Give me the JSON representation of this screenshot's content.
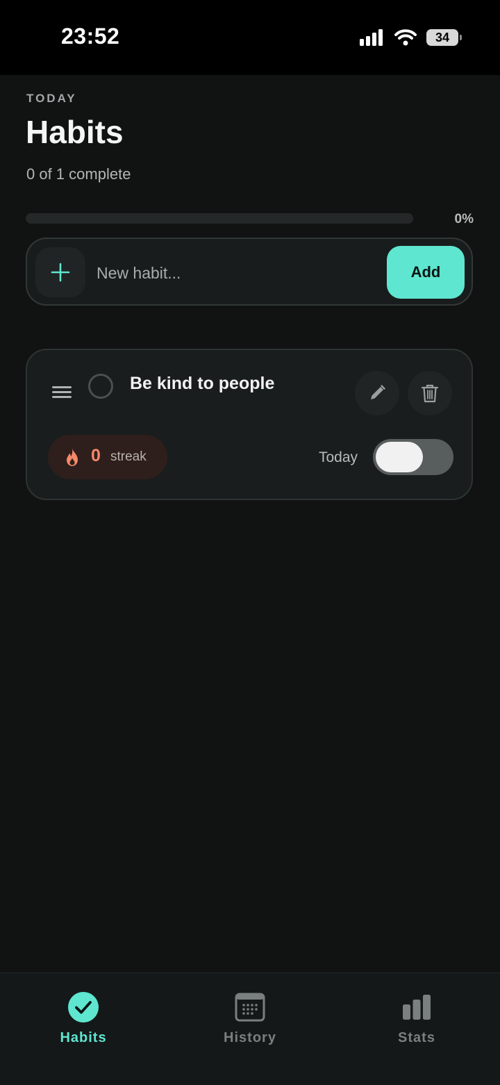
{
  "status_bar": {
    "time": "23:52",
    "battery": "34"
  },
  "header": {
    "eyebrow": "TODAY",
    "title": "Habits",
    "subtitle": "0 of 1 complete"
  },
  "progress": {
    "value": 0,
    "label": "0%"
  },
  "add_habit": {
    "placeholder": "New habit...",
    "button_label": "Add"
  },
  "habits": [
    {
      "name": "Be kind to people",
      "completed": false,
      "streak_count": "0",
      "streak_label": "streak",
      "today_label": "Today",
      "today_done": false
    }
  ],
  "tabs": [
    {
      "label": "Habits",
      "icon": "check-circle-icon",
      "active": true
    },
    {
      "label": "History",
      "icon": "calendar-icon",
      "active": false
    },
    {
      "label": "Stats",
      "icon": "bar-chart-icon",
      "active": false
    }
  ],
  "colors": {
    "accent": "#5ee6d0",
    "background": "#111313",
    "card": "#1a1d1d",
    "streak": "#f5896a",
    "tab_inactive": "#7a7f7f"
  }
}
